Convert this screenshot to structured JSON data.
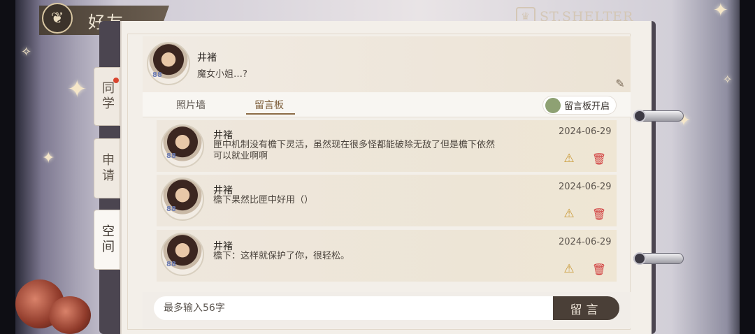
{
  "header": {
    "title": "好友",
    "emblem_icon": "butterfly-icon"
  },
  "brand": {
    "text": "ST.SHELTER",
    "icon": "shelter-crest-icon"
  },
  "side_tabs": [
    {
      "label": "同学",
      "has_notification": true
    },
    {
      "label": "申请"
    },
    {
      "label": "空间",
      "active": true
    }
  ],
  "profile": {
    "name": "井褚",
    "signature": "魔女小姐…?",
    "level": "88"
  },
  "tabs": [
    {
      "label": "照片墙"
    },
    {
      "label": "留言板",
      "active": true
    }
  ],
  "toggle": {
    "label": "留言板开启",
    "color": "#8ea173"
  },
  "messages": [
    {
      "name": "井褚",
      "text": "匣中机制没有檐下灵活，虽然现在很多怪都能破除无敌了但是檐下依然可以就业啊啊",
      "date": "2024-06-29",
      "level": "88"
    },
    {
      "name": "井褚",
      "text": "檐下果然比匣中好用（）",
      "date": "2024-06-29",
      "level": "88"
    },
    {
      "name": "井褚",
      "text": "檐下：这样就保护了你，很轻松。",
      "date": "2024-06-29",
      "level": "88"
    }
  ],
  "composer": {
    "placeholder": "最多输入56字",
    "send_label": "留言"
  },
  "colors": {
    "accent": "#8c6c46",
    "delete": "#d03b3b",
    "warning": "#c99a36",
    "send_button": "#4a3f37"
  }
}
